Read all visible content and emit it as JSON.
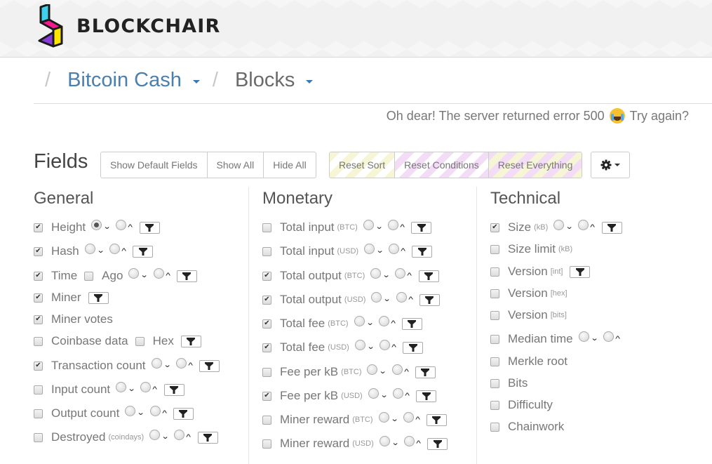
{
  "header": {
    "brand": "BLOCKCHAIR"
  },
  "breadcrumb": {
    "separator": "/",
    "items": [
      {
        "label": "Bitcoin Cash"
      },
      {
        "label": "Blocks"
      }
    ]
  },
  "error": {
    "message": "Oh dear! The server returned error 500",
    "emoji": "crying-face",
    "retry": "Try again?"
  },
  "toolbar": {
    "title": "Fields",
    "show_default": "Show Default Fields",
    "show_all": "Show All",
    "hide_all": "Hide All",
    "reset_sort": "Reset Sort",
    "reset_conditions": "Reset Conditions",
    "reset_everything": "Reset Everything",
    "settings_icon": "gear-icon"
  },
  "colors": {
    "link_blue": "#4a7fae",
    "stripe_yellow": "#f6f5d6",
    "stripe_pink": "#f3dcf6"
  },
  "columns": [
    {
      "title": "General",
      "fields": [
        {
          "label": "Height",
          "unit": "",
          "checked": true,
          "sort": true,
          "sort_selected": "desc",
          "filter": true
        },
        {
          "label": "Hash",
          "unit": "",
          "checked": true,
          "sort": true,
          "filter": true
        },
        {
          "label": "Time",
          "unit": "",
          "checked": true,
          "extra_option": "Ago",
          "extra_checked": false,
          "sort": true,
          "filter": true
        },
        {
          "label": "Miner",
          "unit": "",
          "checked": true,
          "sort": false,
          "filter": true
        },
        {
          "label": "Miner votes",
          "unit": "",
          "checked": true,
          "sort": false,
          "filter": false
        },
        {
          "label": "Coinbase data",
          "unit": "",
          "checked": false,
          "extra_option": "Hex",
          "extra_checked": false,
          "sort": false,
          "filter": true
        },
        {
          "label": "Transaction count",
          "unit": "",
          "checked": true,
          "sort": true,
          "filter": true
        },
        {
          "label": "Input count",
          "unit": "",
          "checked": false,
          "sort": true,
          "filter": true
        },
        {
          "label": "Output count",
          "unit": "",
          "checked": false,
          "sort": true,
          "filter": true
        },
        {
          "label": "Destroyed",
          "unit": "(coindays)",
          "checked": false,
          "sort": true,
          "filter": true
        }
      ]
    },
    {
      "title": "Monetary",
      "fields": [
        {
          "label": "Total input",
          "unit": "(BTC)",
          "checked": false,
          "sort": true,
          "filter": true
        },
        {
          "label": "Total input",
          "unit": "(USD)",
          "checked": false,
          "sort": true,
          "filter": true
        },
        {
          "label": "Total output",
          "unit": "(BTC)",
          "checked": true,
          "sort": true,
          "filter": true
        },
        {
          "label": "Total output",
          "unit": "(USD)",
          "checked": true,
          "sort": true,
          "filter": true
        },
        {
          "label": "Total fee",
          "unit": "(BTC)",
          "checked": true,
          "sort": true,
          "filter": true
        },
        {
          "label": "Total fee",
          "unit": "(USD)",
          "checked": true,
          "sort": true,
          "filter": true
        },
        {
          "label": "Fee per kB",
          "unit": "(BTC)",
          "checked": false,
          "sort": true,
          "filter": true
        },
        {
          "label": "Fee per kB",
          "unit": "(USD)",
          "checked": true,
          "sort": true,
          "filter": true
        },
        {
          "label": "Miner reward",
          "unit": "(BTC)",
          "checked": false,
          "sort": true,
          "filter": true
        },
        {
          "label": "Miner reward",
          "unit": "(USD)",
          "checked": false,
          "sort": true,
          "filter": true
        }
      ]
    },
    {
      "title": "Technical",
      "fields": [
        {
          "label": "Size",
          "unit": "(kB)",
          "checked": true,
          "sort": true,
          "filter": true
        },
        {
          "label": "Size limit",
          "unit": "(kB)",
          "checked": false,
          "sort": false,
          "filter": false
        },
        {
          "label": "Version",
          "unit": "[int]",
          "checked": false,
          "sort": false,
          "filter": true
        },
        {
          "label": "Version",
          "unit": "[hex]",
          "checked": false,
          "sort": false,
          "filter": false
        },
        {
          "label": "Version",
          "unit": "[bits]",
          "checked": false,
          "sort": false,
          "filter": false
        },
        {
          "label": "Median time",
          "unit": "",
          "checked": false,
          "sort": true,
          "filter": false
        },
        {
          "label": "Merkle root",
          "unit": "",
          "checked": false,
          "sort": false,
          "filter": false
        },
        {
          "label": "Bits",
          "unit": "",
          "checked": false,
          "sort": false,
          "filter": false
        },
        {
          "label": "Difficulty",
          "unit": "",
          "checked": false,
          "sort": false,
          "filter": false
        },
        {
          "label": "Chainwork",
          "unit": "",
          "checked": false,
          "sort": false,
          "filter": false
        }
      ]
    }
  ]
}
